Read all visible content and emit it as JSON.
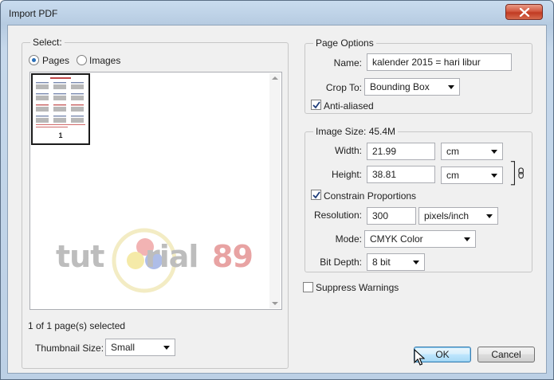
{
  "window": {
    "title": "Import PDF"
  },
  "select_panel": {
    "legend": "Select:",
    "radio_pages": "Pages",
    "radio_images": "Images",
    "selected_mode": "Pages",
    "thumbnail_page_number": "1",
    "selection_status": "1 of 1 page(s) selected",
    "thumbnail_size_label": "Thumbnail Size:",
    "thumbnail_size_value": "Small"
  },
  "watermark": {
    "left": "tut",
    "middle": "rial",
    "right": "89"
  },
  "page_options": {
    "legend": "Page Options",
    "name_label": "Name:",
    "name_value": "kalender 2015 = hari libur",
    "crop_label": "Crop To:",
    "crop_value": "Bounding Box",
    "anti_aliased_label": "Anti-aliased",
    "anti_aliased_checked": true
  },
  "image_size": {
    "legend": "Image Size: 45.4M",
    "width_label": "Width:",
    "width_value": "21.99",
    "width_unit": "cm",
    "height_label": "Height:",
    "height_value": "38.81",
    "height_unit": "cm",
    "constrain_label": "Constrain Proportions",
    "constrain_checked": true,
    "resolution_label": "Resolution:",
    "resolution_value": "300",
    "resolution_unit": "pixels/inch",
    "mode_label": "Mode:",
    "mode_value": "CMYK Color",
    "bit_depth_label": "Bit Depth:",
    "bit_depth_value": "8 bit"
  },
  "suppress_warnings_label": "Suppress Warnings",
  "suppress_warnings_checked": false,
  "buttons": {
    "ok": "OK",
    "cancel": "Cancel"
  },
  "colors": {
    "title_gradient_top": "#c9dcef",
    "client_bg": "#f0f0f0",
    "close_button": "#c13a22",
    "default_button_border": "#3c7fb1",
    "radio_dot": "#2a6fb8"
  }
}
